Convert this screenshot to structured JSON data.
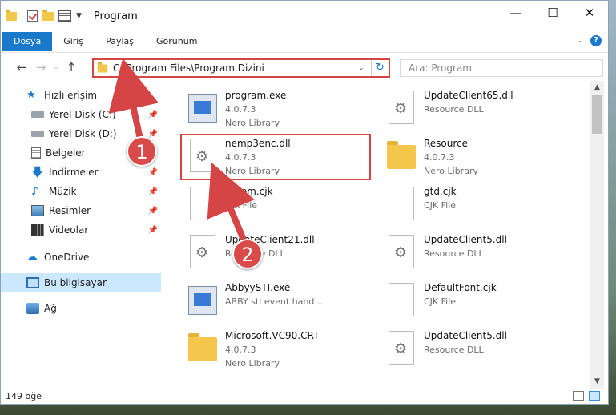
{
  "window": {
    "title": "Program",
    "controls": {
      "minimize": "—",
      "maximize": "☐",
      "close": "✕"
    }
  },
  "ribbon": {
    "tabs": [
      "Dosya",
      "Giriş",
      "Paylaş",
      "Görünüm"
    ],
    "active_tab": "Dosya",
    "help": "?"
  },
  "address": {
    "path": "C:\\Program Files\\Program Dizini",
    "search_placeholder": "Ara: Program"
  },
  "sidebar": {
    "items": [
      {
        "label": "Hızlı erişim",
        "icon": "star-icon",
        "pinned": false
      },
      {
        "label": "Yerel Disk (C:)",
        "icon": "drive-icon",
        "pinned": true
      },
      {
        "label": "Yerel Disk (D:)",
        "icon": "drive-icon",
        "pinned": true
      },
      {
        "label": "Belgeler",
        "icon": "documents-icon",
        "pinned": true
      },
      {
        "label": "İndirmeler",
        "icon": "download-icon",
        "pinned": true
      },
      {
        "label": "Müzik",
        "icon": "music-icon",
        "pinned": true
      },
      {
        "label": "Resimler",
        "icon": "pictures-icon",
        "pinned": true
      },
      {
        "label": "Videolar",
        "icon": "video-icon",
        "pinned": true
      },
      {
        "label": "OneDrive",
        "icon": "onedrive-icon",
        "pinned": false
      },
      {
        "label": "Bu bilgisayar",
        "icon": "computer-icon",
        "pinned": false,
        "selected": true
      },
      {
        "label": "Ağ",
        "icon": "network-icon",
        "pinned": false
      }
    ]
  },
  "files": [
    {
      "name": "program.exe",
      "line2": "4.0.7.3",
      "line3": "Nero Library",
      "kind": "exe"
    },
    {
      "name": "UpdateClient65.dll",
      "line2": "Resource DLL",
      "line3": "",
      "kind": "dll"
    },
    {
      "name": "nemp3enc.dll",
      "line2": "4.0.7.3",
      "line3": "Nero Library",
      "kind": "dll"
    },
    {
      "name": "Resource",
      "line2": "4.0.7.3",
      "line3": "Nero Library",
      "kind": "folder"
    },
    {
      "name": "...Com.cjk",
      "line2": "CJK File",
      "line3": "",
      "kind": "file"
    },
    {
      "name": "gtd.cjk",
      "line2": "CJK File",
      "line3": "",
      "kind": "file"
    },
    {
      "name": "UpdateClient21.dll",
      "line2": "Resource DLL",
      "line3": "",
      "kind": "dll"
    },
    {
      "name": "UpdateClient5.dll",
      "line2": "Resource DLL",
      "line3": "",
      "kind": "dll"
    },
    {
      "name": "AbbyySTI.exe",
      "line2": "ABBY sti event hand...",
      "line3": "",
      "kind": "exe"
    },
    {
      "name": "DefaultFont.cjk",
      "line2": "CJK File",
      "line3": "",
      "kind": "file"
    },
    {
      "name": "Microsoft.VC90.CRT",
      "line2": "4.0.7.3",
      "line3": "Nero Library",
      "kind": "folder"
    },
    {
      "name": "UpdateClient5.dll",
      "line2": "Resource DLL",
      "line3": "",
      "kind": "dll"
    }
  ],
  "status": {
    "count": "149 öğe"
  },
  "annotations": {
    "badge1": "1",
    "badge2": "2"
  },
  "colors": {
    "accent": "#1979ca",
    "highlight": "#d64545"
  }
}
